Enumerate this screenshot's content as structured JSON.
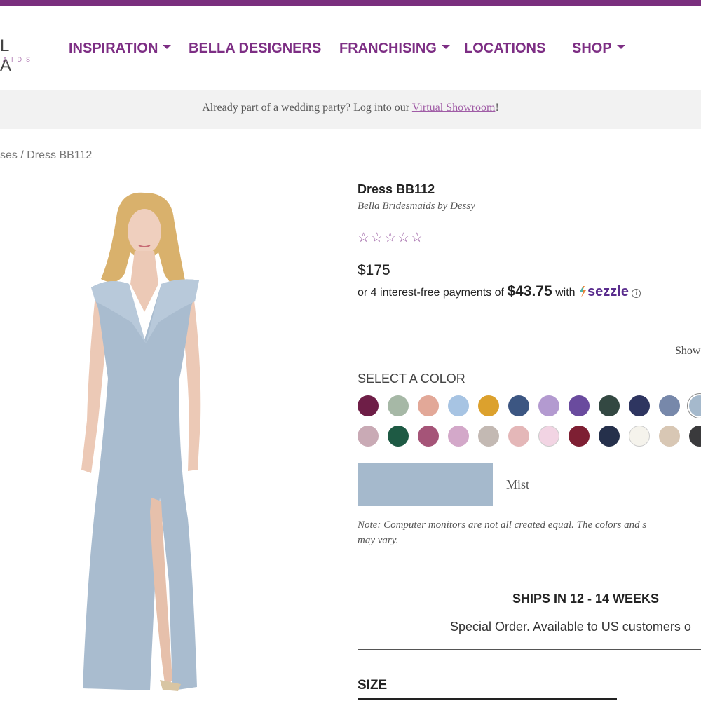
{
  "header": {
    "logo_main": "L A",
    "logo_sub": "AIDS",
    "nav": [
      {
        "label": "INSPIRATION",
        "dropdown": true
      },
      {
        "label": "BELLA DESIGNERS",
        "dropdown": false
      },
      {
        "label": "FRANCHISING",
        "dropdown": true
      },
      {
        "label": "LOCATIONS",
        "dropdown": false
      },
      {
        "label": "SHOP",
        "dropdown": true
      }
    ]
  },
  "banner": {
    "text": "Already part of a wedding party? Log into our ",
    "link": "Virtual Showroom",
    "suffix": "!"
  },
  "breadcrumb": "ses / Dress BB112",
  "product": {
    "title": "Dress BB112",
    "designer": "Bella Bridesmaids by Dessy",
    "rating": "☆☆☆☆☆",
    "price": "$175",
    "installments_prefix": "or 4 interest-free payments of ",
    "installment_amount": "$43.75",
    "installments_with": " with ",
    "sezzle": "sezzle",
    "show_link": "Show"
  },
  "colors": {
    "label": "SELECT A COLOR",
    "selected_name": "Mist",
    "selected_hex": "#a5b9cc",
    "row1": [
      "#6e1e47",
      "#a6b8a6",
      "#e2a898",
      "#a7c4e3",
      "#dca12d",
      "#3c5682",
      "#b39ad0",
      "#6a4b9e",
      "#334842",
      "#2e3560",
      "#7788aa",
      "#a5b9cc"
    ],
    "row2": [
      "#c9aab5",
      "#1e5a44",
      "#a55478",
      "#d3a8c9",
      "#c3b9b3",
      "#e4b7b8",
      "#f2d4e3",
      "#7e1f33",
      "#25304b",
      "#f5f3ec",
      "#d8c7b4",
      "#3a3a3c"
    ]
  },
  "note": {
    "line1": "Note: Computer monitors are not all created equal. The colors and s",
    "line2": "may vary."
  },
  "shipping": {
    "title": "SHIPS IN 12 - 14 WEEKS",
    "subtitle": "Special Order. Available to US customers o"
  },
  "size": {
    "label": "SIZE"
  }
}
